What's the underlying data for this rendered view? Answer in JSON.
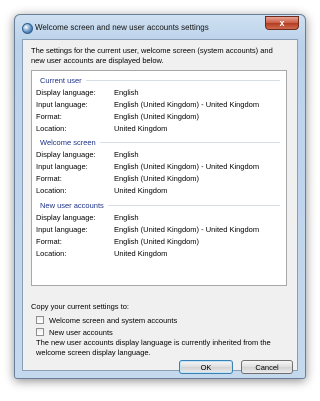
{
  "window": {
    "title": "Welcome screen and new user accounts settings",
    "close_label": "x"
  },
  "intro": "The settings for the current user, welcome screen (system accounts) and new user accounts are displayed below.",
  "groups": [
    {
      "title": "Current user",
      "rows": [
        {
          "label": "Display language:",
          "value": "English"
        },
        {
          "label": "Input language:",
          "value": "English (United Kingdom) - United Kingdom"
        },
        {
          "label": "Format:",
          "value": "English (United Kingdom)"
        },
        {
          "label": "Location:",
          "value": "United Kingdom"
        }
      ]
    },
    {
      "title": "Welcome screen",
      "rows": [
        {
          "label": "Display language:",
          "value": "English"
        },
        {
          "label": "Input language:",
          "value": "English (United Kingdom) - United Kingdom"
        },
        {
          "label": "Format:",
          "value": "English (United Kingdom)"
        },
        {
          "label": "Location:",
          "value": "United Kingdom"
        }
      ]
    },
    {
      "title": "New user accounts",
      "rows": [
        {
          "label": "Display language:",
          "value": "English"
        },
        {
          "label": "Input language:",
          "value": "English (United Kingdom) - United Kingdom"
        },
        {
          "label": "Format:",
          "value": "English (United Kingdom)"
        },
        {
          "label": "Location:",
          "value": "United Kingdom"
        }
      ]
    }
  ],
  "copy": {
    "label": "Copy your current settings to:",
    "options": [
      {
        "label": "Welcome screen and system accounts",
        "checked": false
      },
      {
        "label": "New user accounts",
        "checked": false
      }
    ],
    "note": "The new user accounts display language is currently inherited from the welcome screen display language."
  },
  "buttons": {
    "ok": "OK",
    "cancel": "Cancel"
  }
}
